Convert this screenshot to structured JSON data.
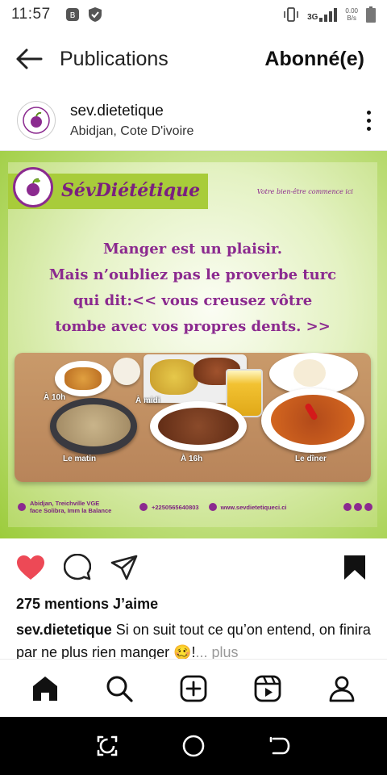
{
  "status_bar": {
    "time": "11:57",
    "network": "3G",
    "speed_value": "0.00",
    "speed_unit": "B/s"
  },
  "header": {
    "title": "Publications",
    "follow_label": "Abonné(e)"
  },
  "post": {
    "username": "sev.dietetique",
    "location": "Abidjan, Cote D'ivoire",
    "likes": "275 mentions J’aime",
    "caption_user": "sev.dietetique",
    "caption_text": " Si on suit tout ce qu’on entend, on finira par ne plus rien manger 🥴!",
    "caption_more": "... plus",
    "liked": true,
    "saved": true
  },
  "image": {
    "brand": "SévDiététique",
    "tagline": "Votre bien-être commence ici",
    "headline": [
      "Manger est un plaisir.",
      "Mais n’oubliez pas le proverbe turc",
      "qui dit:<< vous creusez vôtre",
      "tombe avec vos propres dents. >>"
    ],
    "meal_labels": {
      "a10h": "À 10h",
      "midi": "À midi",
      "matin": "Le matin",
      "a16h": "À 16h",
      "diner": "Le dîner"
    },
    "address_line1": "Abidjan, Treichville VGE",
    "address_line2": "face Solibra, Imm la Balance",
    "phone": "+2250565640803",
    "website": "www.sevdietetiqueci.ci"
  },
  "colors": {
    "brand_purple": "#8b2a8f",
    "brand_green": "#a8cc3a",
    "like_red": "#ed4956"
  }
}
